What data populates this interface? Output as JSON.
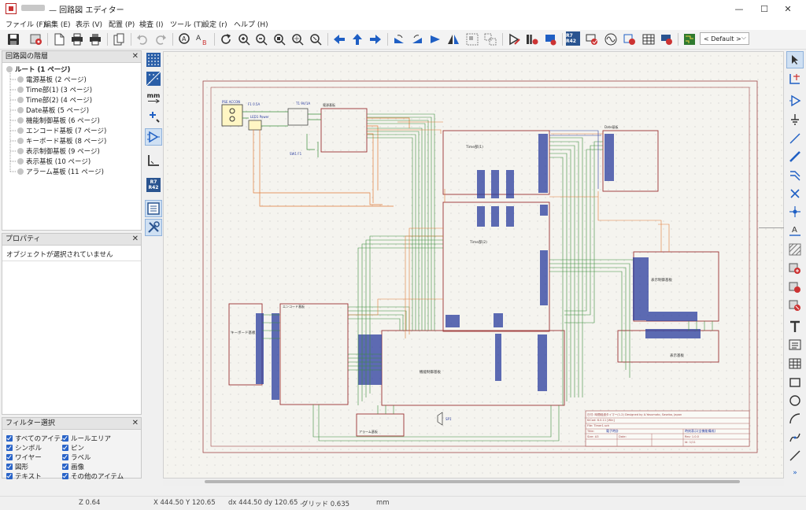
{
  "window": {
    "title": "— 回路図 エディター",
    "controls": {
      "minimize": "—",
      "maximize": "☐",
      "close": "✕"
    }
  },
  "menu": [
    "ファイル (F)",
    "編集 (E)",
    "表示 (V)",
    "配置 (P)",
    "検査 (I)",
    "ツール (T)",
    "設定 (r)",
    "ヘルプ (H)"
  ],
  "toolbar": {
    "view_preset": "< Default >",
    "annotate_label": "R7 R42",
    "pcb_label": "PCB"
  },
  "hierarchy_panel": {
    "title": "回路図の階層",
    "items": [
      "ルート (1 ページ)",
      "電源基板 (2 ページ)",
      "Time部(1) (3 ページ)",
      "Time部(2) (4 ページ)",
      "Date基板 (5 ページ)",
      "機能制御基板 (6 ページ)",
      "エンコード基板 (7 ページ)",
      "キーボード基板 (8 ページ)",
      "表示制御基板 (9 ページ)",
      "表示基板 (10 ページ)",
      "アラーム基板 (11 ページ)"
    ]
  },
  "properties_panel": {
    "title": "プロパティ",
    "empty_text": "オブジェクトが選択されていません"
  },
  "filter_panel": {
    "title": "フィルター選択",
    "items": [
      "すべてのアイテム",
      "ルールエリア",
      "シンボル",
      "ピン",
      "ワイヤー",
      "ラベル",
      "図形",
      "画像",
      "テキスト",
      "その他のアイテム"
    ]
  },
  "left_toolbar": {
    "units_label": "mm",
    "annotate_label": "R7 R42"
  },
  "schematic": {
    "sheets": {
      "power": "電源基板",
      "time1": "Time部(1)",
      "time2": "Time部(2)",
      "date": "Date基板",
      "display_ctrl": "表示制御基板",
      "keyboard": "キーボード基板",
      "encode": "エンコード基板",
      "function": "機能制御基板",
      "display": "表示基板",
      "alarm": "アラーム基板"
    },
    "labels": {
      "ps": "PSE ACCON",
      "f1": "F1 0.5A",
      "t1": "T1 9V/1A",
      "led": "LED1 Power",
      "sw": "SW1 F1",
      "spk": "SP1"
    },
    "title_block": {
      "line1": "日付: 時間経過タイマー(1-2)   Designed by A.Yasumoto, Sasebo, Japan",
      "line2": "KiCad: 6.0.11 [Win]",
      "line3": "File: Timer1.sch",
      "line4": "Title:",
      "title_text": "電子時計",
      "size": "Size: A3",
      "date": "Date:",
      "rev": "Rev: 1.0.0",
      "id": "Id: 1/11",
      "stamp": "時刻表示(全機能構成)"
    }
  },
  "status": {
    "zoom": "Z 0.64",
    "coords": "X 444.50  Y 120.65",
    "delta": "dx 444.50  dy 120.65 ...",
    "grid": "グリッド 0.635",
    "units": "mm"
  },
  "colors": {
    "accent": "#1f5fc4",
    "wire_green": "#3c8d3c",
    "wire_orange": "#e07b3a",
    "sheet_border": "#9c3232",
    "net_blue": "#2a3c9e"
  }
}
